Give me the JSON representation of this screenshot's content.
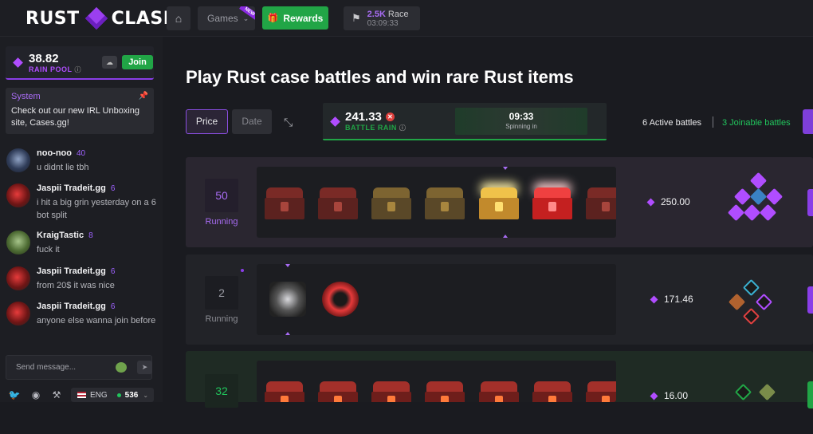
{
  "header": {
    "logo_left": "RUST",
    "logo_right": "CLASH",
    "games_label": "Games",
    "games_badge": "NEW",
    "rewards_label": "Rewards",
    "race_amount": "2.5K",
    "race_label": "Race",
    "race_timer": "03:09:33"
  },
  "sidebar": {
    "rain_pool": {
      "amount": "38.82",
      "label": "RAIN POOL",
      "join_label": "Join"
    },
    "system": {
      "title": "System",
      "text": "Check out our new IRL Unboxing site, Cases.gg!"
    },
    "messages": [
      {
        "name": "noo-noo",
        "level": "40",
        "text": "u didnt lie tbh",
        "avatar": "blue"
      },
      {
        "name": "Jaspii Tradeit.gg",
        "level": "6",
        "text": "i hit a big grin yesterday on a 6 bot split",
        "avatar": "red"
      },
      {
        "name": "KraigTastic",
        "level": "8",
        "text": "fuck it",
        "avatar": "green"
      },
      {
        "name": "Jaspii Tradeit.gg",
        "level": "6",
        "text": "from 20$ it was nice",
        "avatar": "red"
      },
      {
        "name": "Jaspii Tradeit.gg",
        "level": "6",
        "text": "anyone else wanna join before",
        "avatar": "red"
      }
    ],
    "send_placeholder": "Send message...",
    "language": "ENG",
    "online_count": "536"
  },
  "main": {
    "heading": "Play Rust case battles and win rare Rust items",
    "sort_price": "Price",
    "sort_date": "Date",
    "battle_rain": {
      "amount": "241.33",
      "label": "BATTLE RAIN",
      "timer": "09:33",
      "timer_caption": "Spinning in"
    },
    "active_battles": "6 Active battles",
    "joinable_battles": "3 Joinable battles",
    "battles": [
      {
        "rounds": "50",
        "status": "Running",
        "price": "250.00",
        "cases": [
          "red",
          "red",
          "gold",
          "gold",
          "goldbright",
          "redbright",
          "red"
        ]
      },
      {
        "rounds": "2",
        "status": "Running",
        "price": "171.46"
      },
      {
        "rounds": "32",
        "status": "",
        "price": "16.00"
      }
    ]
  },
  "colors": {
    "accent_purple": "#8a3ee8",
    "accent_green": "#21a546",
    "background": "#1a1b20"
  }
}
